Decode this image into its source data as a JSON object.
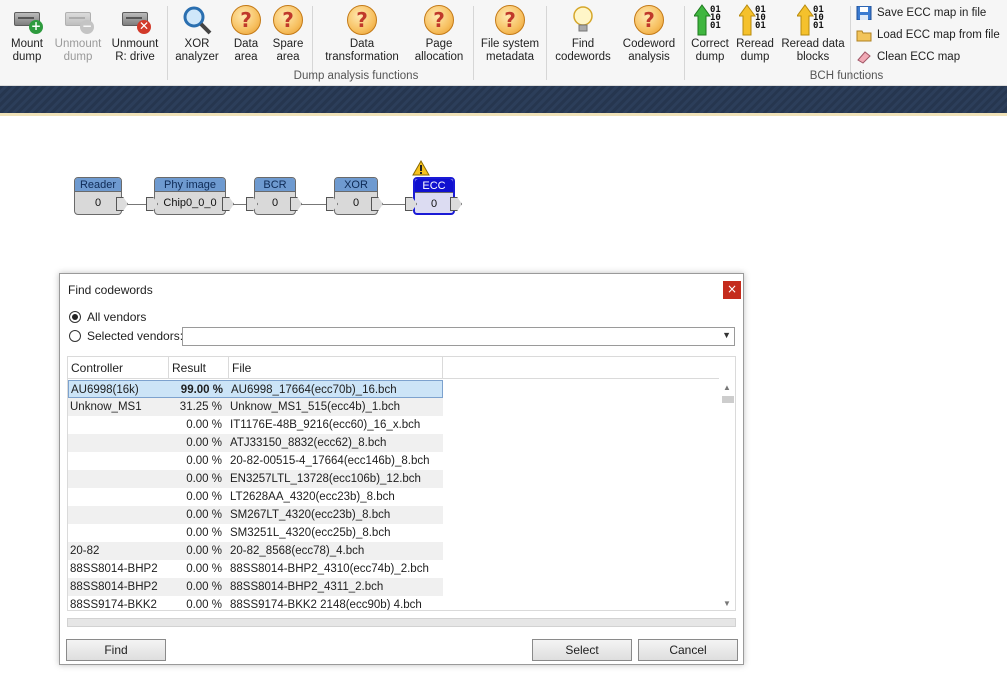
{
  "ribbon": {
    "mount_dump": [
      "Mount",
      "dump"
    ],
    "unmount_dump": [
      "Unmount",
      "dump"
    ],
    "unmount_r": [
      "Unmount",
      "R: drive"
    ],
    "xor_analyzer": [
      "XOR",
      "analyzer"
    ],
    "data_area": [
      "Data",
      "area"
    ],
    "spare_area": [
      "Spare",
      "area"
    ],
    "data_transformation": [
      "Data",
      "transformation"
    ],
    "page_allocation": [
      "Page",
      "allocation"
    ],
    "fs_metadata": [
      "File system",
      "metadata"
    ],
    "find_codewords": [
      "Find",
      "codewords"
    ],
    "codeword_analysis": [
      "Codeword",
      "analysis"
    ],
    "correct_dump": [
      "Correct",
      "dump"
    ],
    "reread_dump": [
      "Reread",
      "dump"
    ],
    "reread_blocks": [
      "Reread data",
      "blocks"
    ],
    "save_ecc": "Save ECC map in file",
    "load_ecc": "Load ECC map from file",
    "clean_ecc": "Clean ECC map",
    "group_dump": "Dump analysis functions",
    "group_bch": "BCH functions"
  },
  "pipeline": {
    "reader": {
      "title": "Reader",
      "value": "0"
    },
    "phy": {
      "title": "Phy image",
      "value": "Chip0_0_0"
    },
    "bcr": {
      "title": "BCR",
      "value": "0"
    },
    "xor": {
      "title": "XOR",
      "value": "0"
    },
    "ecc": {
      "title": "ECC",
      "value": "0"
    }
  },
  "dialog": {
    "title": "Find codewords",
    "close": "×",
    "all_vendors": "All vendors",
    "selected_vendors": "Selected vendors:",
    "columns": {
      "controller": "Controller",
      "result": "Result",
      "file": "File"
    },
    "rows": [
      {
        "controller": "AU6998(16k)",
        "result": "99.00 %",
        "file": "AU6998_17664(ecc70b)_16.bch"
      },
      {
        "controller": "Unknow_MS1",
        "result": "31.25 %",
        "file": "Unknow_MS1_515(ecc4b)_1.bch"
      },
      {
        "controller": "",
        "result": "0.00 %",
        "file": "IT1176E-48B_9216(ecc60)_16_x.bch"
      },
      {
        "controller": "",
        "result": "0.00 %",
        "file": "ATJ33150_8832(ecc62)_8.bch"
      },
      {
        "controller": "",
        "result": "0.00 %",
        "file": "20-82-00515-4_17664(ecc146b)_8.bch"
      },
      {
        "controller": "",
        "result": "0.00 %",
        "file": "EN3257LTL_13728(ecc106b)_12.bch"
      },
      {
        "controller": "",
        "result": "0.00 %",
        "file": "LT2628AA_4320(ecc23b)_8.bch"
      },
      {
        "controller": "",
        "result": "0.00 %",
        "file": "SM267LT_4320(ecc23b)_8.bch"
      },
      {
        "controller": "",
        "result": "0.00 %",
        "file": "SM3251L_4320(ecc25b)_8.bch"
      },
      {
        "controller": "20-82",
        "result": "0.00 %",
        "file": "20-82_8568(ecc78)_4.bch"
      },
      {
        "controller": "88SS8014-BHP2",
        "result": "0.00 %",
        "file": "88SS8014-BHP2_4310(ecc74b)_2.bch"
      },
      {
        "controller": "88SS8014-BHP2",
        "result": "0.00 %",
        "file": "88SS8014-BHP2_4311_2.bch"
      },
      {
        "controller": "88SS9174-BKK2",
        "result": "0.00 %",
        "file": "88SS9174-BKK2 2148(ecc90b) 4.bch"
      }
    ],
    "find": "Find",
    "select": "Select",
    "cancel": "Cancel"
  }
}
